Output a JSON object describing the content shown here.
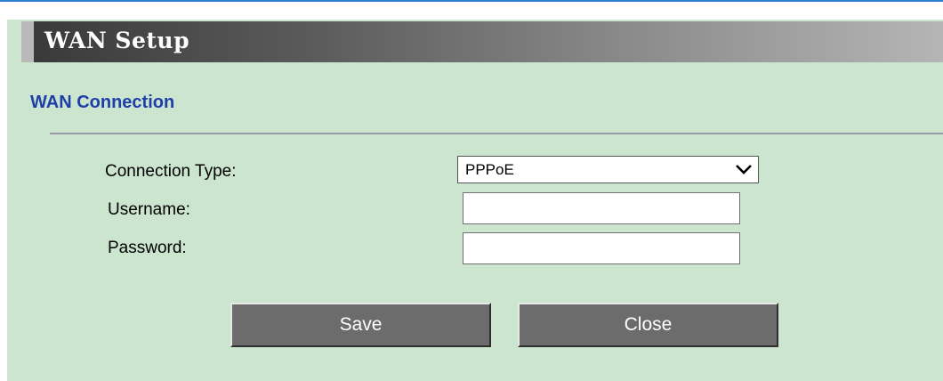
{
  "page": {
    "title": "WAN Setup",
    "section_title": "WAN Connection"
  },
  "form": {
    "connection_type": {
      "label": "Connection Type:",
      "value": "PPPoE"
    },
    "username": {
      "label": "Username:",
      "value": "",
      "placeholder": ""
    },
    "password": {
      "label": "Password:",
      "value": "",
      "placeholder": ""
    }
  },
  "buttons": {
    "save": "Save",
    "close": "Close"
  },
  "icons": {
    "select_arrow": "chevron-down-icon"
  },
  "colors": {
    "panel_background": "#cce5cf",
    "section_title": "#1f3fa8",
    "button": "#6c6c6c",
    "header_gradient_start": "#3a3a3a",
    "header_gradient_end": "#b5b5b5"
  }
}
